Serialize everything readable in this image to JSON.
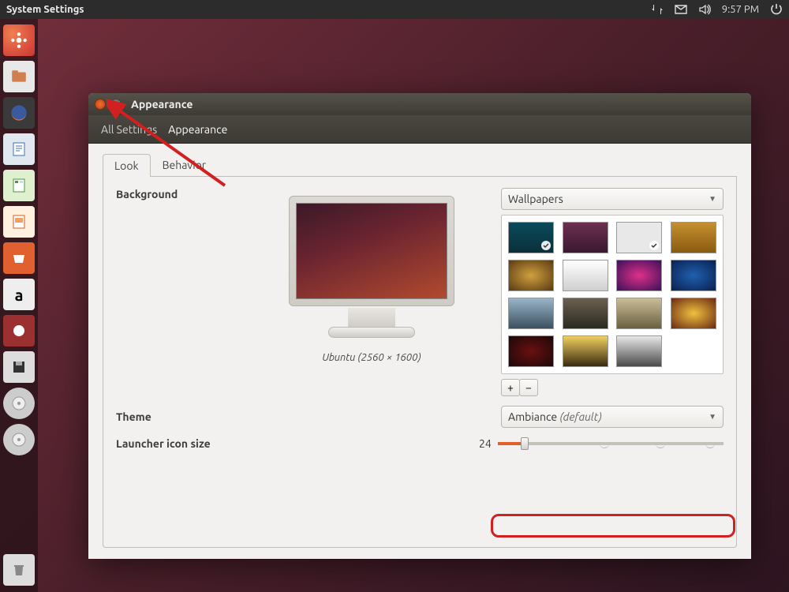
{
  "panel": {
    "title": "System Settings",
    "time": "9:57 PM"
  },
  "window": {
    "title": "Appearance",
    "breadcrumbs": {
      "root": "All Settings",
      "current": "Appearance"
    },
    "tabs": {
      "look": "Look",
      "behavior": "Behavior"
    },
    "background": {
      "heading": "Background",
      "caption": "Ubuntu (2560 × 1600)",
      "source_label": "Wallpapers"
    },
    "theme": {
      "heading": "Theme",
      "value": "Ambiance",
      "suffix": "(default)"
    },
    "launcher_size": {
      "heading": "Launcher icon size",
      "value": "24"
    },
    "pm": {
      "plus": "+",
      "minus": "−"
    }
  }
}
